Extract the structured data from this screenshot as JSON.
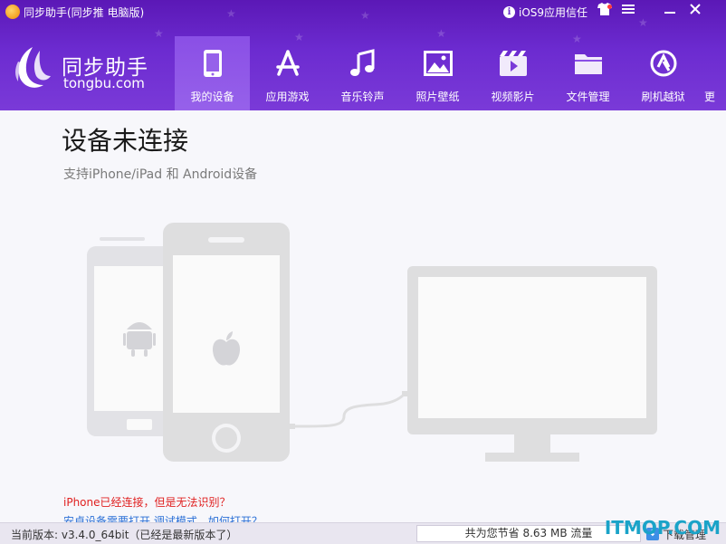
{
  "window": {
    "title": "同步助手(同步推 电脑版)",
    "ios9_trust_label": "iOS9应用信任",
    "controls": [
      "skin-icon",
      "menu-icon",
      "minimize-icon",
      "close-icon"
    ]
  },
  "logo": {
    "cn": "同步助手",
    "en": "tongbu.com"
  },
  "nav": {
    "items": [
      {
        "label": "我的设备",
        "icon": "phone-icon",
        "active": true
      },
      {
        "label": "应用游戏",
        "icon": "app-store-icon",
        "active": false
      },
      {
        "label": "音乐铃声",
        "icon": "music-note-icon",
        "active": false
      },
      {
        "label": "照片壁纸",
        "icon": "photo-icon",
        "active": false
      },
      {
        "label": "视频影片",
        "icon": "video-icon",
        "active": false
      },
      {
        "label": "文件管理",
        "icon": "folder-icon",
        "active": false
      },
      {
        "label": "刷机越狱",
        "icon": "flash-icon",
        "active": false
      },
      {
        "label": "更",
        "icon": "more-icon",
        "active": false
      }
    ]
  },
  "main": {
    "title": "设备未连接",
    "subtitle": "支持iPhone/iPad 和 Android设备",
    "warning_link": "iPhone已经连接，但是无法识别？",
    "tip_link": "安卓设备需要打开 调试模式，如何打开？"
  },
  "status": {
    "version": "当前版本: v3.4.0_64bit（已经是最新版本了）",
    "saving": "共为您节省  8.63 MB 流量",
    "download": "下载管理"
  },
  "watermark": "ITMOP.COM",
  "colors": {
    "header": "#6c2bd0",
    "active_tab": "#8a4fe6",
    "warning": "#e02020",
    "link": "#2a6fd6"
  }
}
